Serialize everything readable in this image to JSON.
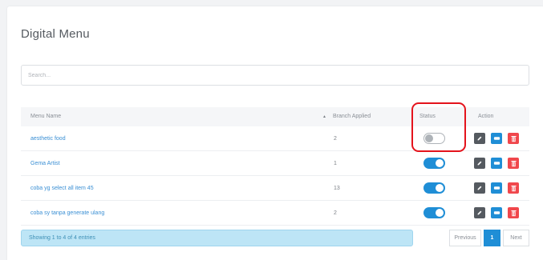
{
  "page": {
    "title": "Digital Menu",
    "search_placeholder": "Search..."
  },
  "table": {
    "columns": {
      "menu_name": "Menu Name",
      "branch_applied": "Branch Applied",
      "status": "Status",
      "action": "Action"
    },
    "rows": [
      {
        "menu_name": "aesthetic food",
        "branch_applied": "2",
        "status": "inactive"
      },
      {
        "menu_name": "Gema Artist",
        "branch_applied": "1",
        "status": "active"
      },
      {
        "menu_name": "coba yg select all item 45",
        "branch_applied": "13",
        "status": "active"
      },
      {
        "menu_name": "coba sy tanpa generate ulang",
        "branch_applied": "2",
        "status": "active"
      }
    ]
  },
  "footer": {
    "info": "Showing 1 to 4 of 4 entries",
    "previous_label": "Previous",
    "current_page": "1",
    "next_label": "Next"
  },
  "icons": {
    "sort": "sort-up-icon",
    "edit": "pencil-icon",
    "view": "eye-icon",
    "delete": "trash-icon"
  },
  "colors": {
    "link": "#3a8fd4",
    "toggle_on": "#1f8ed6",
    "edit_button": "#555a60",
    "view_button": "#1f8ed6",
    "delete_button": "#f0474c",
    "highlight": "#e4131c",
    "info_background": "#bde5f6"
  }
}
